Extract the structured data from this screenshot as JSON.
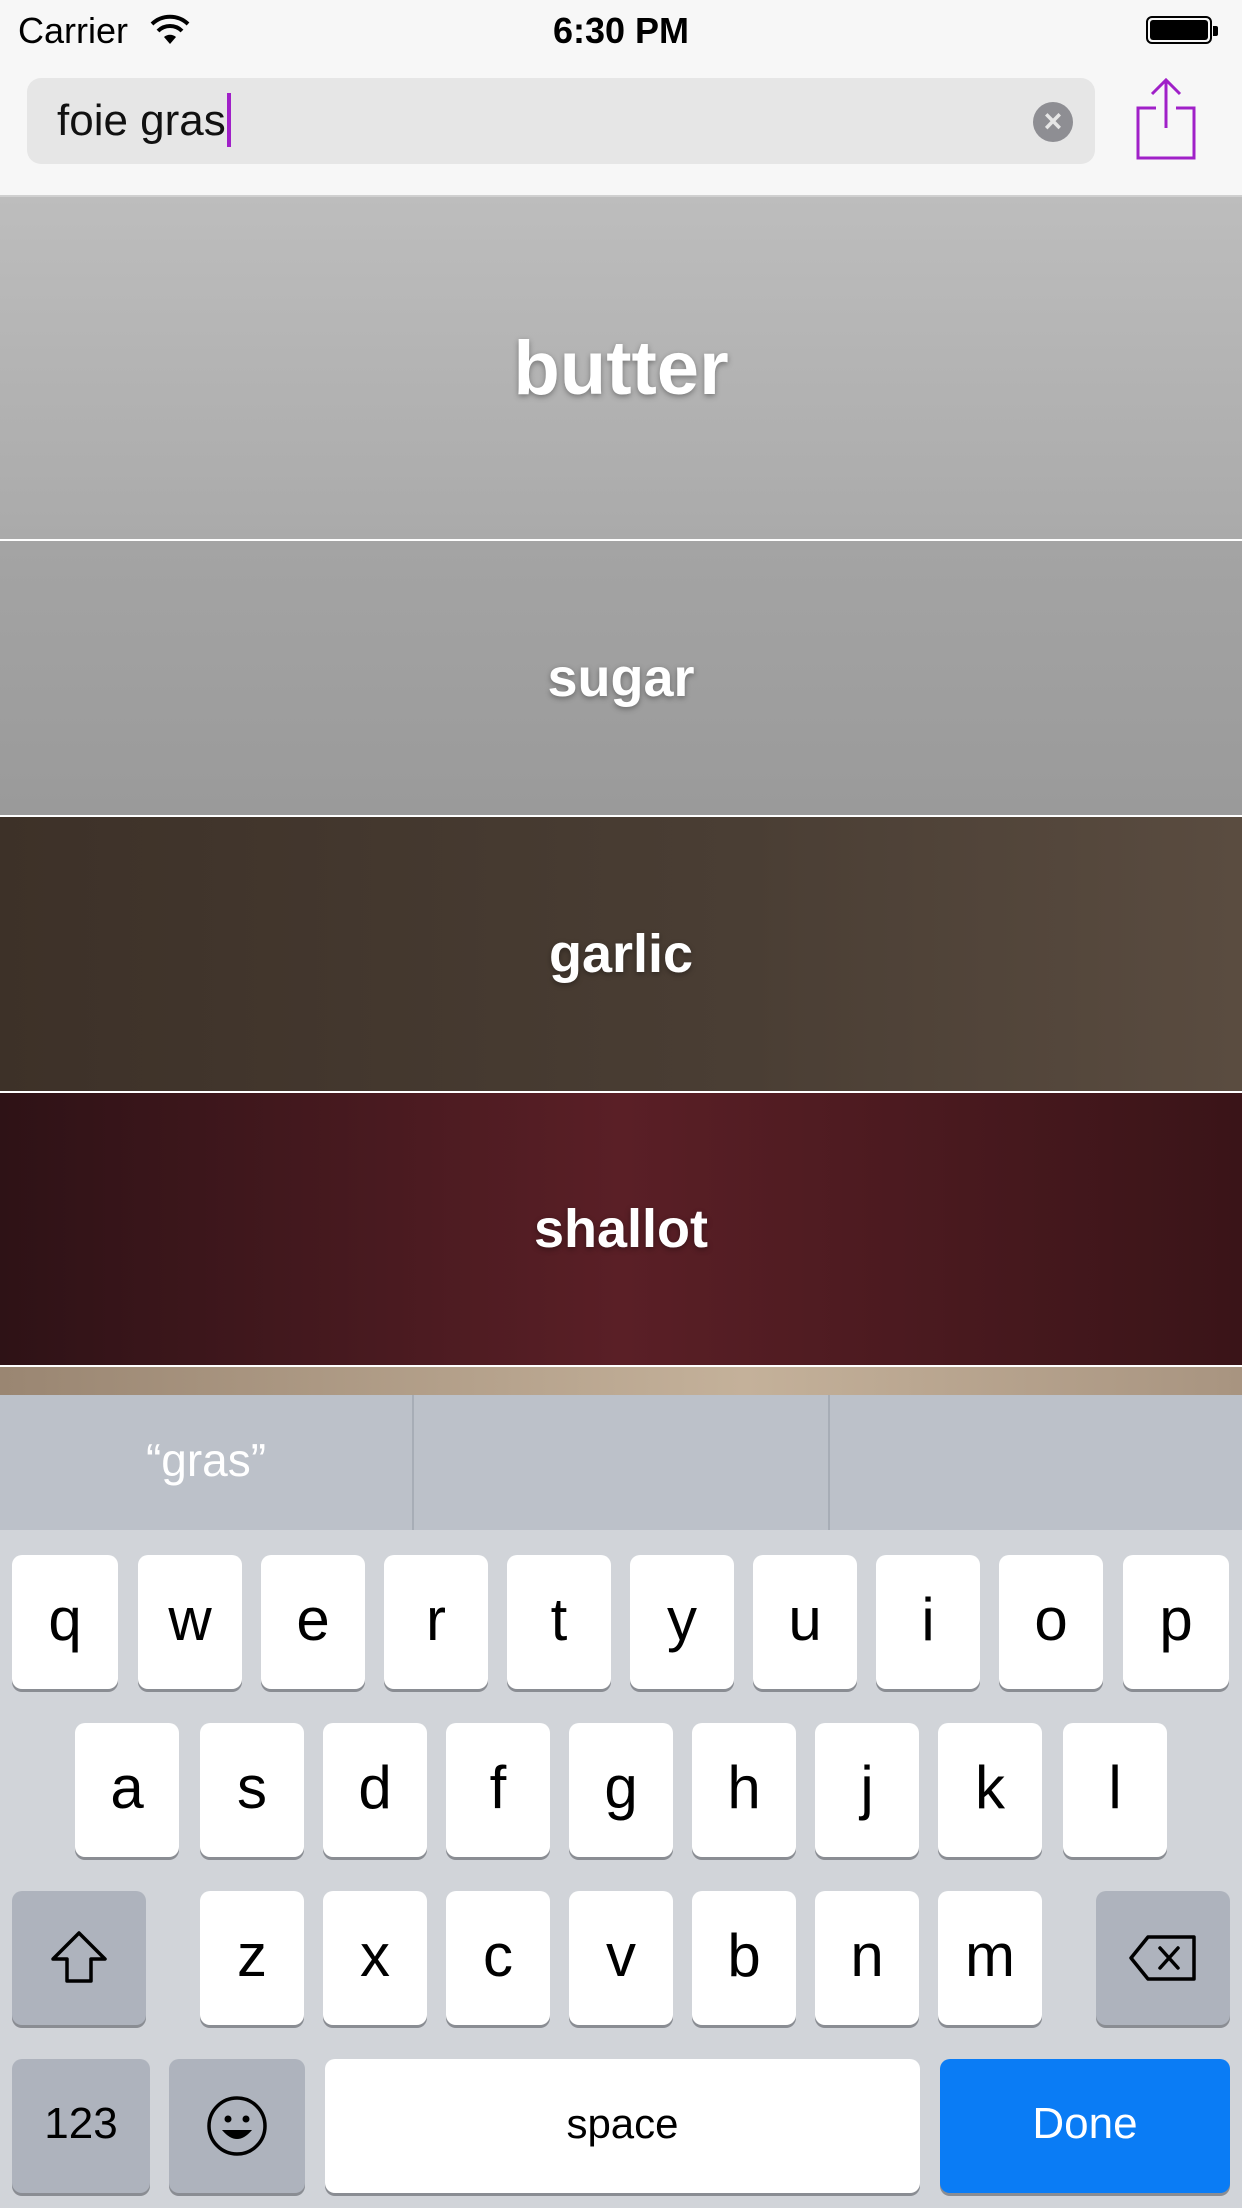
{
  "status_bar": {
    "carrier": "Carrier",
    "time": "6:30 PM"
  },
  "search": {
    "value": "foie gras",
    "clear_icon": "clear-icon",
    "share_icon": "share-icon"
  },
  "ingredients": [
    {
      "name": "butter"
    },
    {
      "name": "sugar"
    },
    {
      "name": "garlic"
    },
    {
      "name": "shallot"
    }
  ],
  "keyboard": {
    "suggestions": [
      "“gras”",
      "",
      ""
    ],
    "row1": [
      "q",
      "w",
      "e",
      "r",
      "t",
      "y",
      "u",
      "i",
      "o",
      "p"
    ],
    "row2": [
      "a",
      "s",
      "d",
      "f",
      "g",
      "h",
      "j",
      "k",
      "l"
    ],
    "row3": [
      "z",
      "x",
      "c",
      "v",
      "b",
      "n",
      "m"
    ],
    "numbers_label": "123",
    "space_label": "space",
    "done_label": "Done",
    "accent_color": "#0a7cf5"
  },
  "colors": {
    "cursor": "#a020c8",
    "share_icon": "#a020c8"
  }
}
